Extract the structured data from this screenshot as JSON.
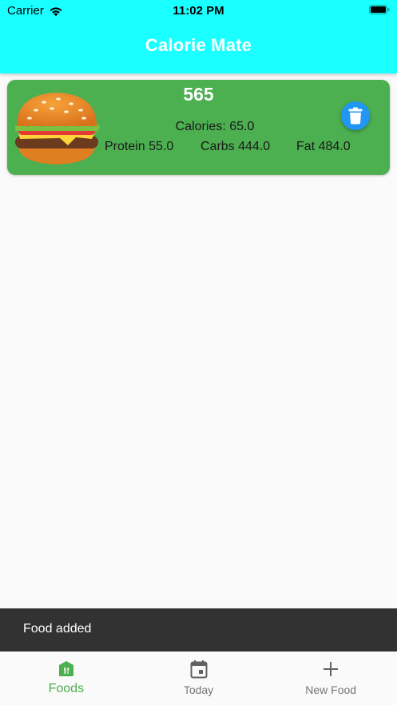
{
  "status_bar": {
    "carrier": "Carrier",
    "time": "11:02 PM"
  },
  "app_bar": {
    "title": "Calorie Mate",
    "color": "#1affff"
  },
  "foods": [
    {
      "name": "565",
      "calories": "Calories: 65.0",
      "protein": "Protein 55.0",
      "carbs": "Carbs 444.0",
      "fat": "Fat 484.0",
      "icon": "burger-icon",
      "card_color": "#4caf50",
      "action_icon": "trash-icon",
      "action_color": "#2196f3"
    }
  ],
  "snackbar": {
    "message": "Food added"
  },
  "bottom_nav": {
    "items": [
      {
        "label": "Foods",
        "icon": "food-store-icon",
        "active": true
      },
      {
        "label": "Today",
        "icon": "calendar-icon",
        "active": false
      },
      {
        "label": "New Food",
        "icon": "plus-icon",
        "active": false
      }
    ],
    "active_color": "#4caf50",
    "inactive_color": "#757575"
  }
}
